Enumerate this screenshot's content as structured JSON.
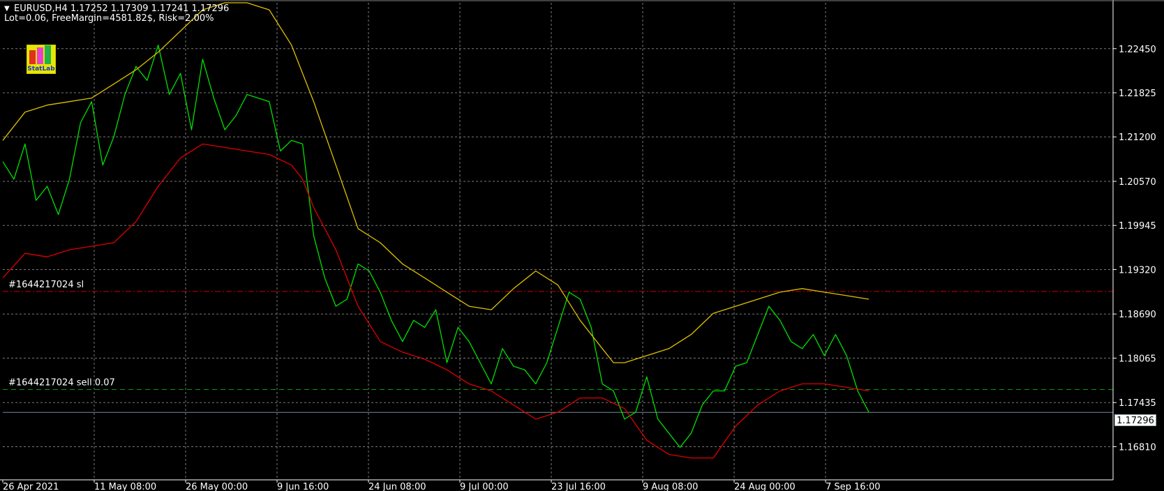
{
  "header": {
    "title": "EURUSD,H4  1.17252 1.17309 1.17241 1.17296",
    "info": "Lot=0.06, FreeMargin=4581.82$, Risk=2.00%"
  },
  "logo": {
    "text": "StatLab"
  },
  "colors": {
    "background": "#000000",
    "grid": "#7a7a7a",
    "axis": "#ffffff",
    "price": "#00e000",
    "ma_slow": "#e0c000",
    "ma_fast": "#e00000",
    "sl_line": "#cc0000",
    "entry_line": "#00a000",
    "current_line": "#6f8fa0"
  },
  "chart_data": {
    "type": "line",
    "symbol": "EURUSD",
    "timeframe": "H4",
    "y_ticks": [
      "1.22450",
      "1.21825",
      "1.21200",
      "1.20570",
      "1.19945",
      "1.19320",
      "1.18690",
      "1.18065",
      "1.17435",
      "1.16810"
    ],
    "x_ticks": [
      "26 Apr 2021",
      "11 May 08:00",
      "26 May 00:00",
      "9 Jun 16:00",
      "24 Jun 08:00",
      "9 Jul 00:00",
      "23 Jul 16:00",
      "9 Aug 08:00",
      "24 Aug 00:00",
      "7 Sep 16:00"
    ],
    "ylim": [
      1.1634,
      1.231
    ],
    "x_range": [
      0,
      100
    ],
    "grid": true,
    "current_price": "1.17296",
    "levels": [
      {
        "name": "#1644217024 sl",
        "price": 1.1901,
        "style": "dash-dot",
        "color": "#cc0000"
      },
      {
        "name": "#1644217024 sell 0.07",
        "price": 1.1762,
        "style": "dashed",
        "color": "#00a000"
      }
    ],
    "series": [
      {
        "key": "price",
        "color": "#00e000",
        "x": [
          0,
          1,
          2,
          3,
          4,
          5,
          6,
          7,
          8,
          9,
          10,
          11,
          12,
          13,
          14,
          15,
          16,
          17,
          18,
          19,
          20,
          21,
          22,
          23,
          24,
          25,
          26,
          27,
          28,
          29,
          30,
          31,
          32,
          33,
          34,
          35,
          36,
          37,
          38,
          39,
          40,
          41,
          42,
          43,
          44,
          45,
          46,
          47,
          48,
          49,
          50,
          51,
          52,
          53,
          54,
          55,
          56,
          57,
          58,
          59,
          60,
          61,
          62,
          63,
          64,
          65,
          66,
          67,
          68,
          69,
          70,
          71,
          72,
          73,
          74,
          75,
          76,
          77,
          78
        ],
        "y": [
          1.2085,
          1.206,
          1.211,
          1.203,
          1.205,
          1.201,
          1.206,
          1.214,
          1.217,
          1.208,
          1.212,
          1.218,
          1.222,
          1.22,
          1.225,
          1.218,
          1.221,
          1.213,
          1.223,
          1.2175,
          1.213,
          1.215,
          1.218,
          1.2175,
          1.217,
          1.21,
          1.2115,
          1.211,
          1.198,
          1.192,
          1.188,
          1.189,
          1.194,
          1.193,
          1.19,
          1.186,
          1.183,
          1.186,
          1.185,
          1.1875,
          1.18,
          1.185,
          1.183,
          1.18,
          1.177,
          1.182,
          1.1795,
          1.179,
          1.177,
          1.18,
          1.185,
          1.19,
          1.189,
          1.185,
          1.177,
          1.176,
          1.172,
          1.173,
          1.178,
          1.172,
          1.17,
          1.168,
          1.17,
          1.174,
          1.176,
          1.176,
          1.1795,
          1.18,
          1.184,
          1.188,
          1.186,
          1.183,
          1.182,
          1.184,
          1.181,
          1.184,
          1.181,
          1.176,
          1.173
        ]
      },
      {
        "key": "ma_slow",
        "color": "#e0c000",
        "x": [
          0,
          2,
          4,
          6,
          8,
          10,
          12,
          14,
          16,
          18,
          20,
          22,
          24,
          26,
          28,
          30,
          32,
          34,
          36,
          38,
          40,
          42,
          44,
          46,
          48,
          50,
          52,
          54,
          55,
          56,
          58,
          60,
          62,
          64,
          66,
          68,
          70,
          72,
          74,
          76,
          78
        ],
        "y": [
          1.2115,
          1.2155,
          1.2165,
          1.217,
          1.2175,
          1.2195,
          1.2215,
          1.224,
          1.227,
          1.23,
          1.231,
          1.231,
          1.23,
          1.225,
          1.217,
          1.208,
          1.199,
          1.197,
          1.194,
          1.192,
          1.19,
          1.188,
          1.1875,
          1.1905,
          1.193,
          1.191,
          1.186,
          1.182,
          1.18,
          1.18,
          1.181,
          1.182,
          1.184,
          1.187,
          1.188,
          1.189,
          1.19,
          1.1905,
          1.19,
          1.1895,
          1.189
        ]
      },
      {
        "key": "ma_fast",
        "color": "#e00000",
        "x": [
          0,
          2,
          4,
          6,
          8,
          10,
          12,
          14,
          16,
          18,
          20,
          22,
          24,
          26,
          27,
          28,
          30,
          32,
          34,
          36,
          38,
          40,
          42,
          44,
          46,
          48,
          50,
          52,
          54,
          56,
          58,
          60,
          62,
          64,
          66,
          68,
          70,
          72,
          74,
          76,
          78
        ],
        "y": [
          1.192,
          1.1955,
          1.195,
          1.196,
          1.1965,
          1.197,
          1.2,
          1.205,
          1.209,
          1.211,
          1.2105,
          1.21,
          1.2095,
          1.208,
          1.206,
          1.202,
          1.196,
          1.188,
          1.183,
          1.1815,
          1.1805,
          1.179,
          1.177,
          1.176,
          1.174,
          1.172,
          1.173,
          1.175,
          1.175,
          1.1735,
          1.169,
          1.167,
          1.1665,
          1.1665,
          1.171,
          1.174,
          1.176,
          1.177,
          1.177,
          1.1765,
          1.176
        ]
      }
    ]
  }
}
